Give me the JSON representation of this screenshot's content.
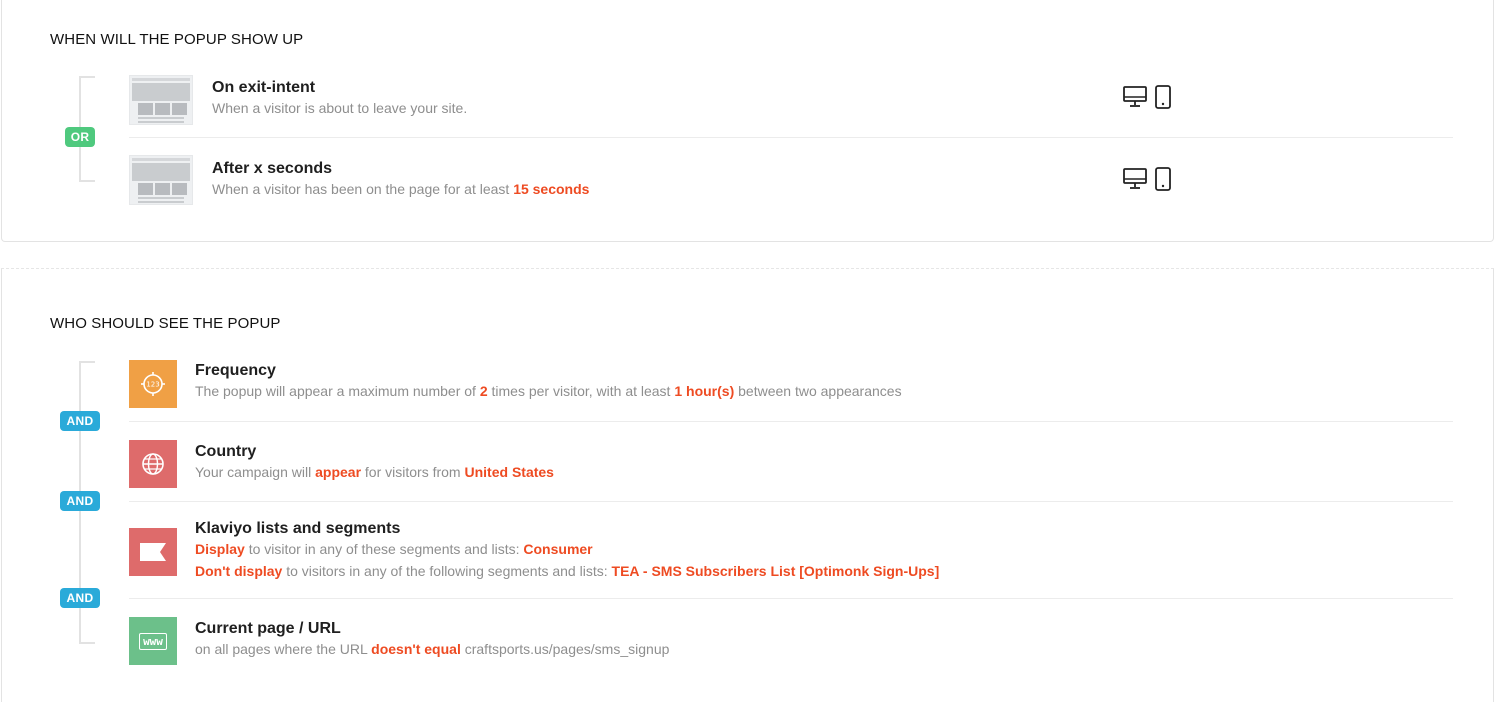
{
  "when_section": {
    "title": "WHEN WILL THE POPUP SHOW UP",
    "connector": "OR",
    "items": [
      {
        "title": "On exit-intent",
        "desc": "When a visitor is about to leave your site.",
        "devices": [
          "desktop-icon",
          "mobile-icon"
        ]
      },
      {
        "title": "After x seconds",
        "desc_prefix": "When a visitor has been on the page for at least ",
        "desc_value": "15 seconds",
        "devices": [
          "desktop-icon",
          "mobile-icon"
        ]
      }
    ]
  },
  "who_section": {
    "title": "WHO SHOULD SEE THE POPUP",
    "connector": "AND",
    "items": [
      {
        "title": "Frequency",
        "icon": "frequency-icon",
        "color": "#f0a045",
        "parts": [
          "The popup will appear a maximum number of ",
          "2",
          " times per visitor, with at least ",
          "1 hour(s)",
          " between two appearances"
        ]
      },
      {
        "title": "Country",
        "icon": "globe-icon",
        "color": "#de6b6b",
        "parts": [
          "Your campaign will ",
          "appear",
          " for visitors from ",
          "United States"
        ]
      },
      {
        "title": "Klaviyo lists and segments",
        "icon": "flag-icon",
        "color": "#de6b6b",
        "line1": [
          "Display",
          " to visitor in any of these segments and lists: ",
          "Consumer"
        ],
        "line2": [
          "Don't display",
          " to visitors in any of the following segments and lists: ",
          "TEA - SMS Subscribers List [Optimonk Sign-Ups]"
        ]
      },
      {
        "title": "Current page / URL",
        "icon": "www-icon",
        "icon_text": "www",
        "color": "#6cc08a",
        "parts": [
          "on all pages where the URL ",
          "doesn't equal",
          " craftsports.us/pages/sms_signup"
        ]
      }
    ]
  },
  "colors": {
    "highlight": "#ee4b22",
    "or_badge": "#4fc97e",
    "and_badge": "#2aaad9"
  }
}
